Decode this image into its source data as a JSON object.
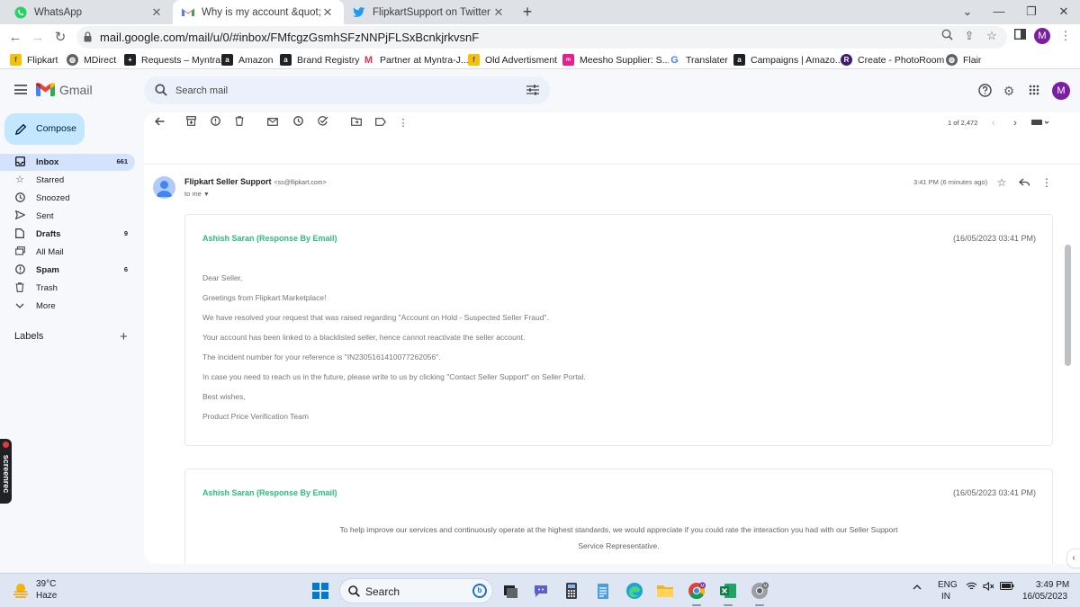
{
  "browser": {
    "tabs": [
      {
        "title": "WhatsApp",
        "icon": "whatsapp-icon"
      },
      {
        "title": "Why is my account &quot;On Ho",
        "icon": "gmail-icon"
      },
      {
        "title": "FlipkartSupport on Twitter: \"@Pr",
        "icon": "twitter-icon"
      }
    ],
    "new_tab": "+",
    "url": "mail.google.com/mail/u/0/#inbox/FMfcgzGsmhSFzNNPjFLSxBcnkjrkvsnF",
    "profile_initial": "M"
  },
  "bookmarks": [
    {
      "label": "Flipkart",
      "icon": "flipkart-icon",
      "color": "#f7c100"
    },
    {
      "label": "MDirect",
      "icon": "globe-icon",
      "color": "#5f6368"
    },
    {
      "label": "Requests – Myntra",
      "icon": "plus-square-icon",
      "color": "#202124"
    },
    {
      "label": "Amazon",
      "icon": "amazon-icon",
      "color": "#202124"
    },
    {
      "label": "Brand Registry",
      "icon": "amazon-icon",
      "color": "#202124"
    },
    {
      "label": "Partner at Myntra-J...",
      "icon": "myntra-icon",
      "color": "#e8304e"
    },
    {
      "label": "Old Advertisment",
      "icon": "flipkart-icon",
      "color": "#f7c100"
    },
    {
      "label": "Meesho Supplier: S...",
      "icon": "meesho-icon",
      "color": "#e91e8c"
    },
    {
      "label": "Translater",
      "icon": "google-icon",
      "color": "#4285f4"
    },
    {
      "label": "Campaigns | Amazo...",
      "icon": "amazon-icon",
      "color": "#202124"
    },
    {
      "label": "Create - PhotoRoom",
      "icon": "photoroom-icon",
      "color": "#3c1a78"
    },
    {
      "label": "Flair",
      "icon": "globe-icon",
      "color": "#5f6368"
    }
  ],
  "gmail": {
    "product_name": "Gmail",
    "search_placeholder": "Search mail",
    "avatar_initial": "M",
    "compose_label": "Compose",
    "nav": [
      {
        "label": "Inbox",
        "count": "661",
        "icon": "inbox-icon"
      },
      {
        "label": "Starred",
        "count": "",
        "icon": "star-icon"
      },
      {
        "label": "Snoozed",
        "count": "",
        "icon": "clock-icon"
      },
      {
        "label": "Sent",
        "count": "",
        "icon": "send-icon"
      },
      {
        "label": "Drafts",
        "count": "9",
        "icon": "draft-icon"
      },
      {
        "label": "All Mail",
        "count": "",
        "icon": "all-mail-icon"
      },
      {
        "label": "Spam",
        "count": "6",
        "icon": "spam-icon"
      },
      {
        "label": "Trash",
        "count": "",
        "icon": "trash-icon"
      },
      {
        "label": "More",
        "count": "",
        "icon": "chevron-down-icon"
      }
    ],
    "labels_heading": "Labels",
    "labels_add": "+",
    "page_info": "1 of 2,472"
  },
  "message": {
    "sender_name": "Flipkart Seller Support",
    "sender_email": "<ss@flipkart.com>",
    "to_line": "to me",
    "timestamp": "3:41 PM (6 minutes ago)",
    "responses": [
      {
        "responder": "Ashish Saran (Response By Email)",
        "date": "(16/05/2023 03:41 PM)",
        "lines": [
          "Dear Seller,",
          "Greetings from Flipkart Marketplace!",
          "We have resolved your request that was raised regarding \"Account on Hold - Suspected Seller Fraud\".",
          "Your account has been linked to a blacklisted seller, hence cannot reactivate the seller account.",
          "The incident number for your reference is \"IN2305161410077262056\".",
          "In case you need to reach us in the future, please write to us by clicking \"Contact Seller Support\" on Seller Portal.",
          "Best wishes,",
          "Product Price Verification Team"
        ]
      },
      {
        "responder": "Ashish Saran (Response By Email)",
        "date": "(16/05/2023 03:41 PM)",
        "lines": [
          "To help improve our services and continuously operate at the highest standards, we would appreciate if you could rate the interaction you had with our Seller Support",
          "Service Representative."
        ]
      }
    ]
  },
  "overlay": {
    "screenrec_label": "screenrec"
  },
  "taskbar": {
    "temperature": "39°C",
    "condition": "Haze",
    "search_placeholder": "Search",
    "lang_line1": "ENG",
    "lang_line2": "IN",
    "time": "3:49 PM",
    "date": "16/05/2023"
  },
  "colors": {
    "accent_green": "#2bbd7e",
    "compose_bg": "#c2e7ff",
    "active_nav": "#d3e3fd",
    "profile": "#7b1fa2"
  }
}
